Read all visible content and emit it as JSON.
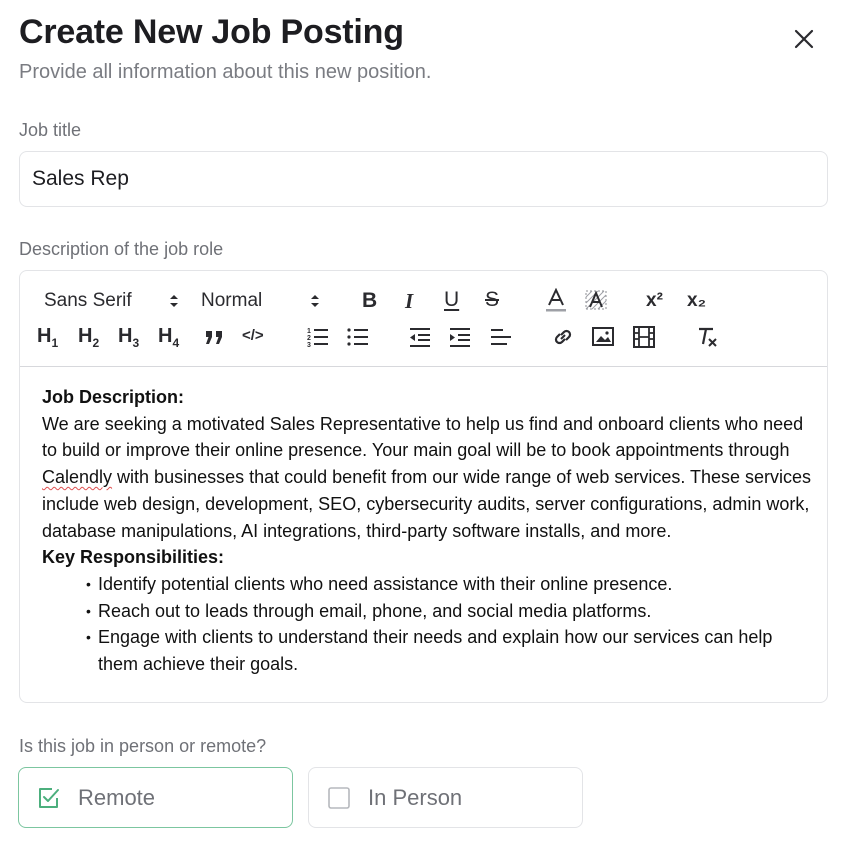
{
  "header": {
    "title": "Create New Job Posting",
    "subtitle": "Provide all information about this new position."
  },
  "icons": {
    "close": "close-icon",
    "check": "checkbox-checked-icon"
  },
  "colors": {
    "selected_border": "#7cc6a0",
    "check_color": "#4caf7d",
    "text_primary": "#1d1d21",
    "text_muted": "#6f7177"
  },
  "job_title": {
    "label": "Job title",
    "value": "Sales Rep"
  },
  "description": {
    "label": "Description of the job role",
    "toolbar": {
      "font_select": "Sans Serif",
      "size_select": "Normal",
      "bold": "B",
      "italic": "I",
      "underline": "U",
      "strike": "S",
      "h1": "H",
      "h2": "H",
      "h3": "H",
      "h4": "H",
      "h1_sub": "1",
      "h2_sub": "2",
      "h3_sub": "3",
      "h4_sub": "4",
      "quote": "99",
      "code": "</>",
      "superscript": "x²",
      "subscript": "x₂"
    },
    "content": {
      "heading1": "Job Description:",
      "line1_pre": "We are seeking a motivated Sales Representative to help us find and onboard clients who need to build or improve their online presence. Your main goal will be to book appointments through ",
      "misspelled": "Calendly",
      "line1_post": " with businesses that could benefit from our wide range of web services. These services include web design, development, SEO, cybersecurity audits, server configurations, admin work, database manipulations, AI integrations, third-party software installs, and more.",
      "heading2": "Key Responsibilities:",
      "bullets": [
        "Identify potential clients who need assistance with their online presence.",
        "Reach out to leads through email, phone, and social media platforms.",
        "Engage with clients to understand their needs and explain how our services can help them achieve their goals."
      ]
    }
  },
  "work_type": {
    "label": "Is this job in person or remote?",
    "options": [
      {
        "label": "Remote",
        "selected": true
      },
      {
        "label": "In Person",
        "selected": false
      }
    ]
  }
}
